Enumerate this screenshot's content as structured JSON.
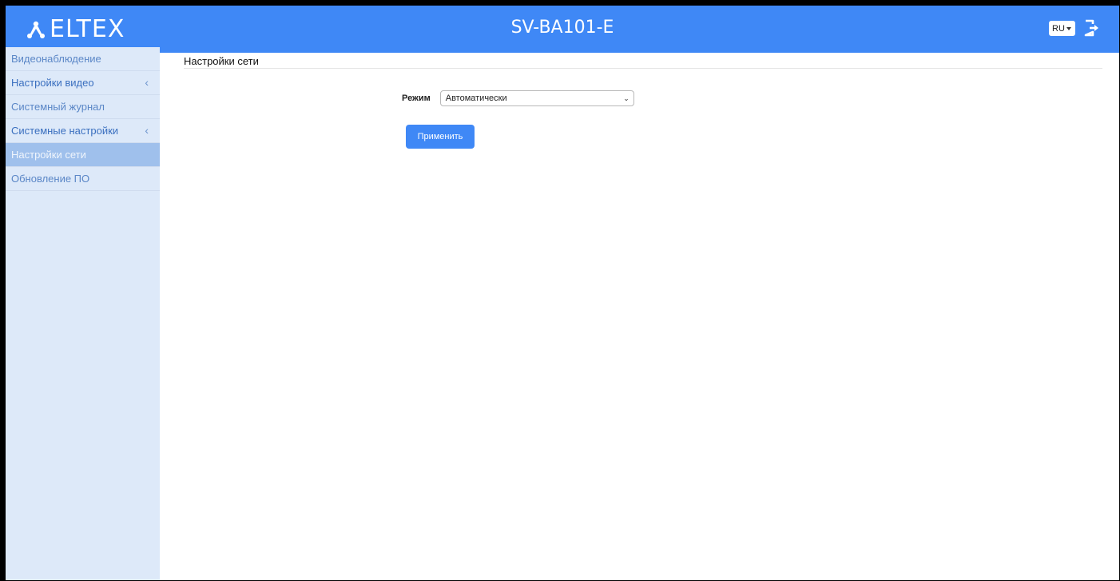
{
  "header": {
    "logo_text": "ELTEX",
    "device_name": "SV-BA101-E",
    "language": "RU"
  },
  "sidebar": {
    "items": [
      {
        "label": "Видеонаблюдение"
      },
      {
        "label": "Настройки видео",
        "chevron": "‹"
      },
      {
        "label": "Системный журнал"
      },
      {
        "label": "Системные настройки",
        "chevron": "‹"
      },
      {
        "label": "Настройки сети"
      },
      {
        "label": "Обновление ПО"
      }
    ]
  },
  "main": {
    "title": "Настройки сети",
    "mode_label": "Режим",
    "mode_value": "Автоматически",
    "apply_label": "Применить"
  },
  "colors": {
    "accent": "#3f88f6",
    "sidebar_bg": "#dde9f9",
    "sidebar_active": "#9fc0ec"
  },
  "icons": {
    "logo": "eltex-logo-icon",
    "logout": "logout-icon",
    "dropdown": "chevron-down-icon",
    "expand": "chevron-left-icon"
  }
}
